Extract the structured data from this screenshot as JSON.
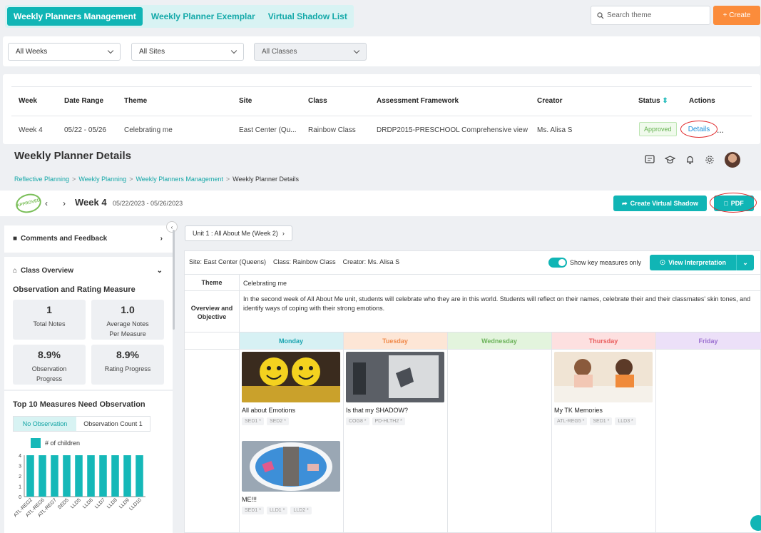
{
  "tabs": [
    {
      "label": "Weekly Planners Management",
      "active": true
    },
    {
      "label": "Weekly Planner Exemplar",
      "active": false
    },
    {
      "label": "Virtual Shadow List",
      "active": false
    }
  ],
  "search": {
    "placeholder": "Search theme"
  },
  "create_label": "+ Create",
  "filters": {
    "weeks": "All Weeks",
    "sites": "All Sites",
    "classes": "All Classes"
  },
  "table": {
    "headers": [
      "Week",
      "Date Range",
      "Theme",
      "Site",
      "Class",
      "Assessment Framework",
      "Creator",
      "Status",
      "Actions"
    ],
    "row": {
      "week": "Week 4",
      "date_range": "05/22 - 05/26",
      "theme": "Celebrating me",
      "site": "East Center (Qu...",
      "class": "Rainbow Class",
      "framework": "DRDP2015-PRESCHOOL Comprehensive view",
      "creator": "Ms. Alisa S",
      "status": "Approved",
      "action": "Details",
      "more": "..."
    }
  },
  "details": {
    "title": "Weekly Planner Details",
    "breadcrumb": [
      "Reflective Planning",
      "Weekly Planning",
      "Weekly Planners Management",
      "Weekly Planner Details"
    ],
    "stamp": "APPROVED",
    "week_label": "Week 4",
    "week_range": "05/22/2023 - 05/26/2023",
    "create_shadow_label": "Create Virtual Shadow",
    "pdf_label": "PDF"
  },
  "left_panel": {
    "comments_label": "Comments and Feedback",
    "class_overview_label": "Class Overview",
    "obs_title": "Observation and Rating Measure",
    "stats": [
      {
        "value": "1",
        "label": "Total Notes"
      },
      {
        "value": "1.0",
        "label": "Average Notes Per Measure"
      },
      {
        "value": "8.9%",
        "label": "Observation Progress"
      },
      {
        "value": "8.9%",
        "label": "Rating Progress"
      }
    ],
    "top_title": "Top 10 Measures Need Observation",
    "toggle": [
      "No Observation",
      "Observation Count 1"
    ],
    "legend": "# of children"
  },
  "chart_data": {
    "type": "bar",
    "categories": [
      "ATL-REG2",
      "ATL-REG6",
      "ATL-REG7",
      "SED5",
      "LLD5",
      "LLD6",
      "LLD7",
      "LLD8",
      "LLD9",
      "LLD10"
    ],
    "series": [
      {
        "name": "# of children",
        "values": [
          4,
          4,
          4,
          4,
          4,
          4,
          4,
          4,
          4,
          4
        ]
      }
    ],
    "ylim": [
      0,
      4
    ],
    "yticks": [
      "0",
      "1",
      "2",
      "3",
      "4"
    ],
    "color": "#15b8b8"
  },
  "main": {
    "unit_label": "Unit 1 : All About Me (Week 2)",
    "info": "Site: East Center (Queens)    Class: Rainbow Class    Creator: Ms. Alisa S",
    "key_measures_label": "Show key measures only",
    "view_interp_label": "View Interpretation",
    "theme_label": "Theme",
    "theme_value": "Celebrating me",
    "overview_label": "Overview and Objective",
    "overview_value": "In the second week of All About Me unit, students will celebrate who they are in this world. Students will reflect on their names, celebrate their and their classmates' skin tones, and identify ways of coping with their strong emotions.",
    "days": [
      {
        "label": "Monday",
        "bg": "#d7f1f4",
        "fg": "#1aa5b0"
      },
      {
        "label": "Tuesday",
        "bg": "#fde6d6",
        "fg": "#f08a4b"
      },
      {
        "label": "Wednesday",
        "bg": "#e3f4dd",
        "fg": "#6cb35a"
      },
      {
        "label": "Thursday",
        "bg": "#fde0e0",
        "fg": "#e95d5d"
      },
      {
        "label": "Friday",
        "bg": "#ece0f8",
        "fg": "#9b6fd0"
      }
    ],
    "cards": [
      {
        "title": "All about Emotions",
        "tags": [
          "SED1 *",
          "SED2 *"
        ]
      },
      {
        "title": "Is that my SHADOW?",
        "tags": [
          "COG8 *",
          "PD-HLTH2 *"
        ]
      },
      {
        "title": "My TK Memories",
        "tags": [
          "ATL-REG5 *",
          "SED1 *",
          "LLD3 *"
        ]
      },
      {
        "title": "ME!!!",
        "tags": [
          "SED1 *",
          "LLD1 *",
          "LLD2 *"
        ]
      }
    ]
  }
}
